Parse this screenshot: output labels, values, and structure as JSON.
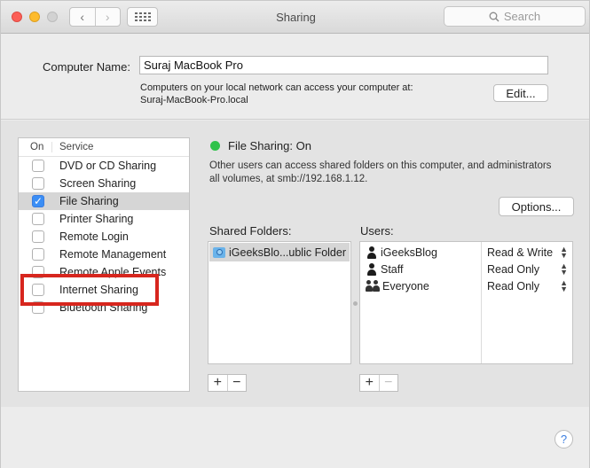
{
  "window": {
    "title": "Sharing"
  },
  "toolbar": {
    "back_glyph": "‹",
    "forward_glyph": "›",
    "search_placeholder": "Search",
    "search_icon": "magnifier-icon",
    "grid_icon": "show-all-grid-icon"
  },
  "computer_name": {
    "label": "Computer Name:",
    "value": "Suraj MacBook Pro",
    "desc_line1": "Computers on your local network can access your computer at:",
    "desc_line2": "Suraj-MacBook-Pro.local",
    "edit_label": "Edit..."
  },
  "services": {
    "col_on": "On",
    "col_service": "Service",
    "items": [
      {
        "label": "DVD or CD Sharing",
        "checked": false,
        "selected": false
      },
      {
        "label": "Screen Sharing",
        "checked": false,
        "selected": false
      },
      {
        "label": "File Sharing",
        "checked": true,
        "selected": true
      },
      {
        "label": "Printer Sharing",
        "checked": false,
        "selected": false
      },
      {
        "label": "Remote Login",
        "checked": false,
        "selected": false
      },
      {
        "label": "Remote Management",
        "checked": false,
        "selected": false
      },
      {
        "label": "Remote Apple Events",
        "checked": false,
        "selected": false
      },
      {
        "label": "Internet Sharing",
        "checked": false,
        "selected": false
      },
      {
        "label": "Bluetooth Sharing",
        "checked": false,
        "selected": false
      }
    ]
  },
  "status": {
    "text": "File Sharing: On",
    "color": "#2fc24a",
    "desc_line1": "Other users can access shared folders on this computer, and administrators",
    "desc_line2": "all volumes, at smb://192.168.1.12."
  },
  "options_label": "Options...",
  "shared_folders": {
    "label": "Shared Folders:",
    "items": [
      "iGeeksBlo...ublic Folder"
    ]
  },
  "users": {
    "label": "Users:",
    "items": [
      {
        "name": "iGeeksBlog",
        "permission": "Read & Write",
        "icon": "person-icon"
      },
      {
        "name": "Staff",
        "permission": "Read Only",
        "icon": "person-icon"
      },
      {
        "name": "Everyone",
        "permission": "Read Only",
        "icon": "group-icon"
      }
    ]
  },
  "buttons": {
    "add": "+",
    "remove": "−"
  },
  "help_label": "?",
  "highlight_color": "#d7261e"
}
